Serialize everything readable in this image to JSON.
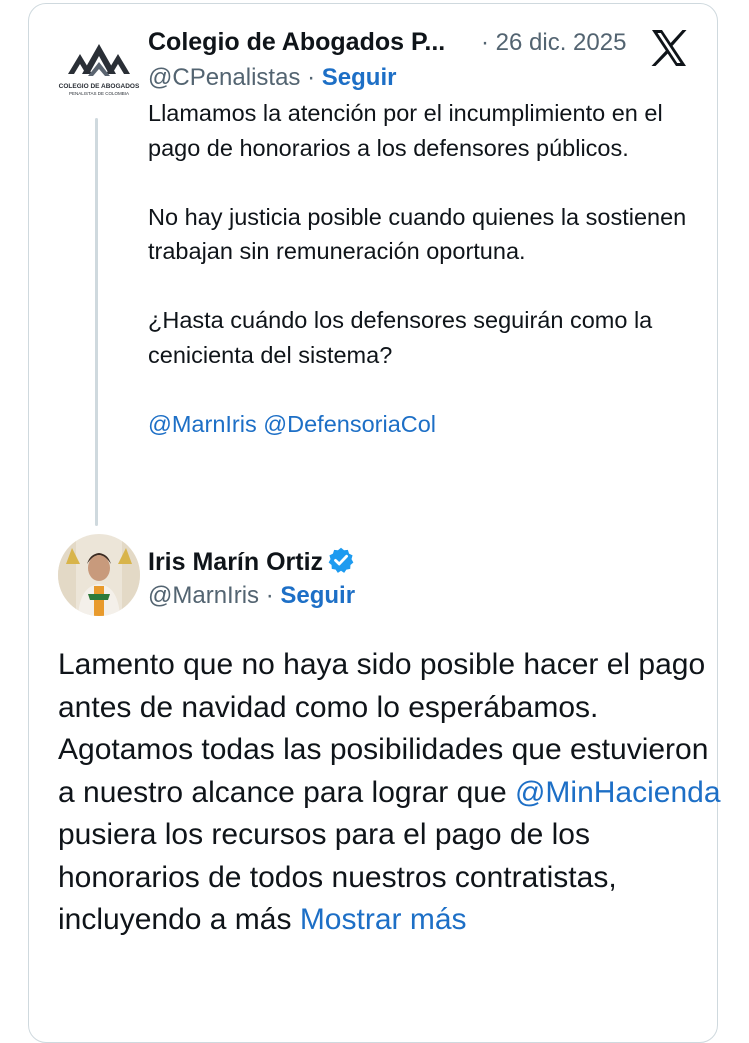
{
  "tweet1": {
    "author_name": "Colegio de Abogados P...",
    "date": "· 26 dic. 2025",
    "handle": "@CPenalistas ·",
    "follow_label": "Seguir",
    "avatar_text_line1": "COLEGIO DE ABOGADOS",
    "avatar_text_line2": "PENALISTAS DE COLOMBIA",
    "paragraphs": [
      "Llamamos la atención por el incumplimiento en el pago de honorarios a los defensores públicos.",
      "No hay justicia posible cuando quienes la sostienen trabajan sin remuneración oportuna.",
      "¿Hasta cuándo los defensores seguirán como la cenicienta del sistema?"
    ],
    "mentions": [
      "@MarnIris",
      "@DefensoriaCol"
    ]
  },
  "tweet2": {
    "author_name": "Iris Marín Ortiz",
    "handle": "@MarnIris ·",
    "follow_label": "Seguir",
    "body_before_mention": "Lamento que no haya sido posible hacer el pago antes de navidad como lo esperábamos. Agotamos todas las posibilidades que estuvieron a nuestro alcance para lograr que ",
    "mention": "@MinHacienda",
    "body_after_mention": " pusiera los recursos para el pago de los honorarios de todos nuestros contratistas, incluyendo a más ",
    "show_more_label": "Mostrar más"
  },
  "colors": {
    "link": "#1d6fc6",
    "text": "#0f1419",
    "muted": "#536471",
    "border": "#cfd9de",
    "verified": "#1d9bf0"
  },
  "icons": [
    "x-logo-icon",
    "verified-badge-icon",
    "org-logo"
  ]
}
